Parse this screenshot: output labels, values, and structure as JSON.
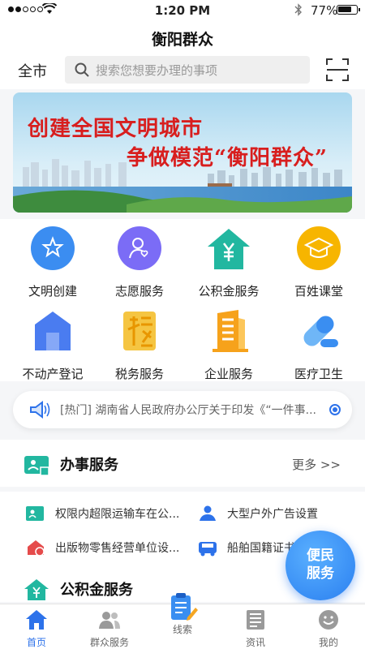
{
  "status_bar": {
    "time": "1:20 PM",
    "battery": "77%"
  },
  "header": {
    "title": "衡阳群众",
    "city": "全市",
    "search_placeholder": "搜索您想要办理的事项"
  },
  "banner": {
    "line1": "创建全国文明城市",
    "line2": "争做模范“衡阳群众”"
  },
  "services_grid": [
    {
      "label": "文明创建",
      "icon": "star-flower-icon"
    },
    {
      "label": "志愿服务",
      "icon": "volunteer-heart-icon"
    },
    {
      "label": "公积金服务",
      "icon": "yen-house-icon"
    },
    {
      "label": "百姓课堂",
      "icon": "graduation-cap-icon"
    },
    {
      "label": "不动产登记",
      "icon": "building-icon"
    },
    {
      "label": "税务服务",
      "icon": "tax-icon"
    },
    {
      "label": "企业服务",
      "icon": "enterprise-building-icon"
    },
    {
      "label": "医疗卫生",
      "icon": "pill-icon"
    }
  ],
  "notice": {
    "text": "[热门] 湖南省人民政府办公厅关于印发《“一件事..."
  },
  "affairs": {
    "title": "办事服务",
    "more": "更多 >>",
    "items": [
      {
        "label": "权限内超限运输车在公...",
        "icon": "license-icon"
      },
      {
        "label": "大型户外广告设置",
        "icon": "person-service-icon"
      },
      {
        "label": "出版物零售经营单位设...",
        "icon": "store-icon"
      },
      {
        "label": "船舶国籍证书",
        "icon": "vehicle-icon"
      }
    ]
  },
  "fund": {
    "title": "公积金服务"
  },
  "float_button": {
    "line1": "便民",
    "line2": "服务"
  },
  "tabs": [
    {
      "label": "首页",
      "active": true
    },
    {
      "label": "群众服务",
      "active": false
    },
    {
      "label": "线索",
      "active": false
    },
    {
      "label": "资讯",
      "active": false
    },
    {
      "label": "我的",
      "active": false
    }
  ],
  "colors": {
    "accent": "#2d72ea",
    "green": "#22b7a0",
    "orange": "#f5a623",
    "banner_red": "#d81e1e"
  }
}
